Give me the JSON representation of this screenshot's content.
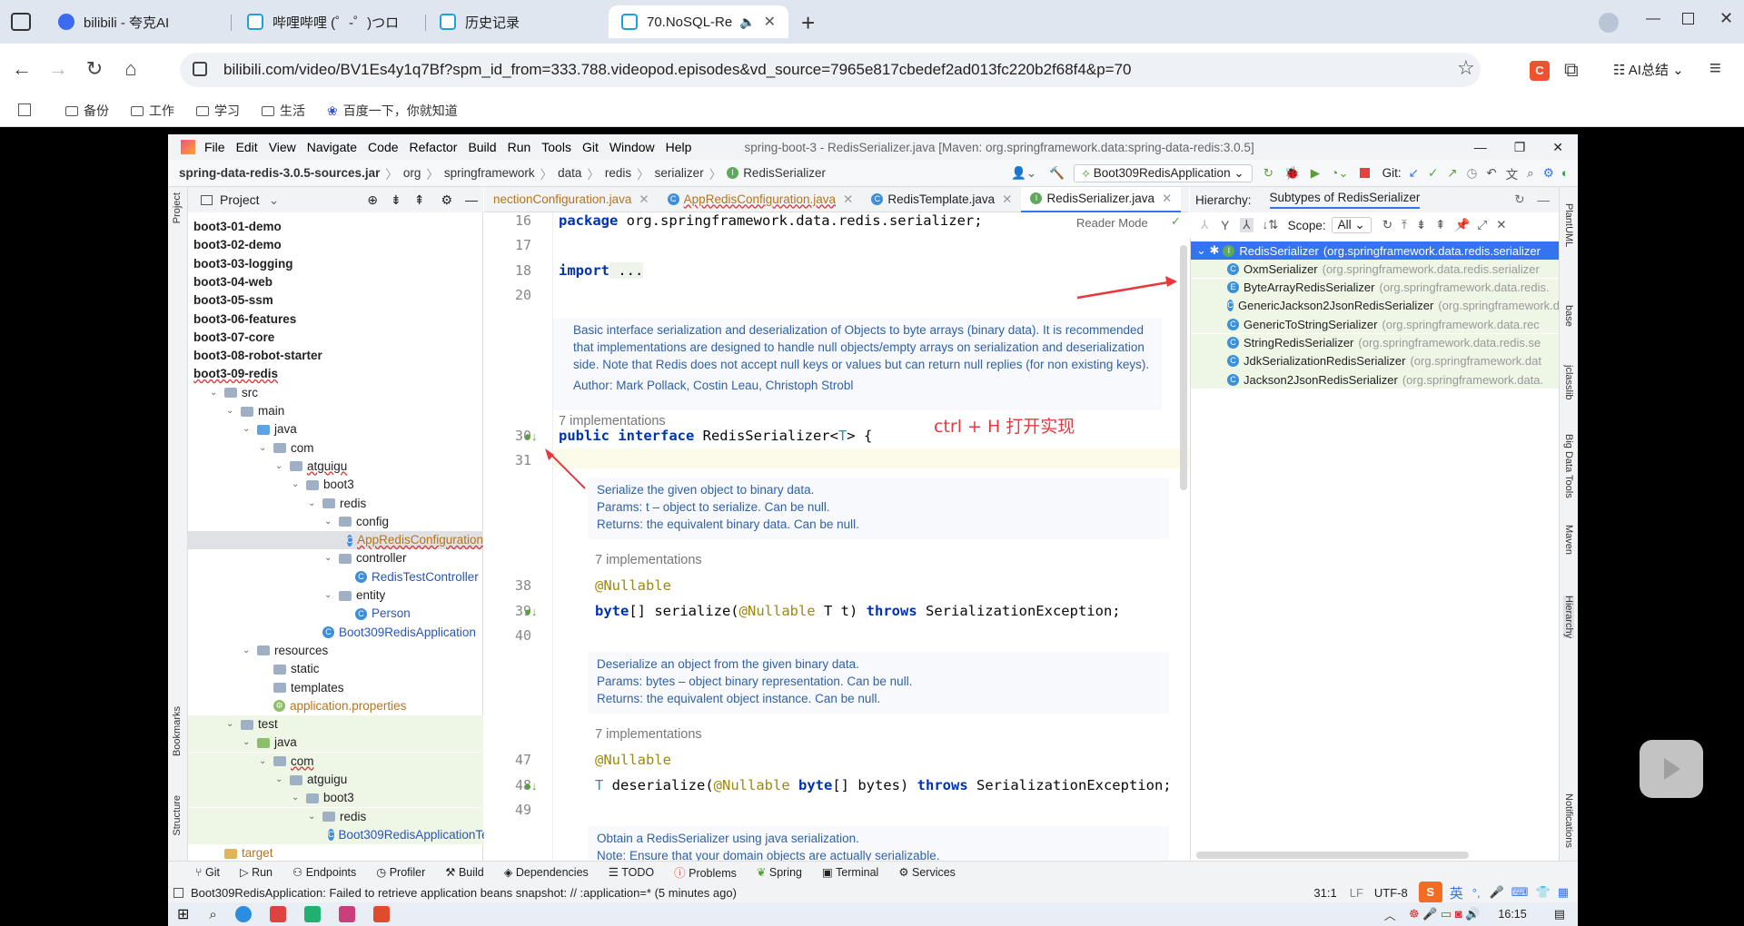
{
  "browser": {
    "tabs": [
      {
        "label": "bilibili - 夸克AI"
      },
      {
        "label": "哔哩哔哩 (゜-゜)つロ"
      },
      {
        "label": "历史记录"
      },
      {
        "label": "70.NoSQL-Re"
      }
    ],
    "url": "bilibili.com/video/BV1Es4y1q7Bf?spm_id_from=333.788.videopod.episodes&vd_source=7965e817cbedef2ad013fc220b2f68f4&p=70",
    "ai_summary_label": "AI总结",
    "bookmarks": [
      "备份",
      "工作",
      "学习",
      "生活",
      "百度一下，你就知道"
    ]
  },
  "ide": {
    "menu": [
      "File",
      "Edit",
      "View",
      "Navigate",
      "Code",
      "Refactor",
      "Build",
      "Run",
      "Tools",
      "Git",
      "Window",
      "Help"
    ],
    "window_title": "spring-boot-3 - RedisSerializer.java [Maven: org.springframework.data:spring-data-redis:3.0.5]",
    "breadcrumb": [
      "spring-data-redis-3.0.5-sources.jar",
      "org",
      "springframework",
      "data",
      "redis",
      "serializer",
      "RedisSerializer"
    ],
    "run_config": "Boot309RedisApplication",
    "git_label": "Git:",
    "project_panel": {
      "title": "Project",
      "tree": [
        {
          "label": "boot3-01-demo",
          "bold": true
        },
        {
          "label": "boot3-02-demo",
          "bold": true
        },
        {
          "label": "boot3-03-logging",
          "bold": true
        },
        {
          "label": "boot3-04-web",
          "bold": true
        },
        {
          "label": "boot3-05-ssm",
          "bold": true
        },
        {
          "label": "boot3-06-features",
          "bold": true
        },
        {
          "label": "boot3-07-core",
          "bold": true
        },
        {
          "label": "boot3-08-robot-starter",
          "bold": true
        },
        {
          "label": "boot3-09-redis",
          "bold": true
        },
        {
          "label": "src"
        },
        {
          "label": "main"
        },
        {
          "label": "java"
        },
        {
          "label": "com"
        },
        {
          "label": "atguigu"
        },
        {
          "label": "boot3"
        },
        {
          "label": "redis"
        },
        {
          "label": "config"
        },
        {
          "label": "AppRedisConfiguration"
        },
        {
          "label": "controller"
        },
        {
          "label": "RedisTestController"
        },
        {
          "label": "entity"
        },
        {
          "label": "Person"
        },
        {
          "label": "Boot309RedisApplication"
        },
        {
          "label": "resources"
        },
        {
          "label": "static"
        },
        {
          "label": "templates"
        },
        {
          "label": "application.properties"
        },
        {
          "label": "test"
        },
        {
          "label": "java"
        },
        {
          "label": "com"
        },
        {
          "label": "atguigu"
        },
        {
          "label": "boot3"
        },
        {
          "label": "redis"
        },
        {
          "label": "Boot309RedisApplicationTest"
        },
        {
          "label": "target"
        }
      ]
    },
    "editor_tabs": [
      {
        "label": "nectionConfiguration.java"
      },
      {
        "label": "AppRedisConfiguration.java"
      },
      {
        "label": "RedisTemplate.java"
      },
      {
        "label": "RedisSerializer.java"
      }
    ],
    "reader_mode": "Reader Mode",
    "line_numbers": [
      "16",
      "17",
      "18",
      "20",
      "30",
      "31",
      "38",
      "39",
      "40",
      "47",
      "48",
      "49"
    ],
    "code": {
      "package_kw": "package",
      "package_name": " org.springframework.data.redis.serializer;",
      "import_kw": "import",
      "import_rest": " ...",
      "doc1": "Basic interface serialization and deserialization of Objects to byte arrays (binary data). It is recommended that implementations are designed to handle null objects/empty arrays on serialization and deserialization side. Note that Redis does not accept null keys or values but can return null replies (for non existing keys).",
      "doc1_author": "Author: Mark Pollack, Costin Leau, Christoph Strobl",
      "impl1": "7 implementations",
      "iface_kw": "public interface",
      "iface_name": " RedisSerializer<",
      "iface_t": "T",
      "iface_end": "> {",
      "doc2_line1": "Serialize the given object to binary data.",
      "doc2_line2": "Params: t – object to serialize. Can be null.",
      "doc2_line3": "Returns: the equivalent binary data. Can be null.",
      "impl2": "7 implementations",
      "nullable1": "@Nullable",
      "serialize_kw": "byte",
      "serialize_rest": "[] serialize(",
      "serialize_ann": "@Nullable",
      "serialize_param": " T t) ",
      "serialize_throws": "throws",
      "serialize_end": " SerializationException;",
      "doc3_line1": "Deserialize an object from the given binary data.",
      "doc3_line2": "Params: bytes – object binary representation. Can be null.",
      "doc3_line3": "Returns: the equivalent object instance. Can be null.",
      "impl3": "7 implementations",
      "nullable2": "@Nullable",
      "deser_t": "T",
      "deser_rest": " deserialize(",
      "deser_ann": "@Nullable",
      "deser_kw": " byte",
      "deser_param": "[] bytes) ",
      "deser_throws": "throws",
      "deser_end": " SerializationException;",
      "doc4_line1": "Obtain a RedisSerializer using java serialization.",
      "doc4_line2": "Note: Ensure that your domain objects are actually serializable."
    },
    "annotation_text": "ctrl + H 打开实现",
    "hierarchy": {
      "label": "Hierarchy:",
      "tab": "Subtypes of RedisSerializer",
      "scope_label": "Scope:",
      "scope_value": "All",
      "root": {
        "name": "RedisSerializer",
        "pkg": "(org.springframework.data.redis.serializer"
      },
      "items": [
        {
          "name": "OxmSerializer",
          "pkg": "(org.springframework.data.redis.serializer"
        },
        {
          "name": "ByteArrayRedisSerializer",
          "pkg": "(org.springframework.data.redis."
        },
        {
          "name": "GenericJackson2JsonRedisSerializer",
          "pkg": "(org.springframework.d"
        },
        {
          "name": "GenericToStringSerializer",
          "pkg": "(org.springframework.data.rec"
        },
        {
          "name": "StringRedisSerializer",
          "pkg": "(org.springframework.data.redis.se"
        },
        {
          "name": "JdkSerializationRedisSerializer",
          "pkg": "(org.springframework.dat"
        },
        {
          "name": "Jackson2JsonRedisSerializer",
          "pkg": "(org.springframework.data."
        }
      ]
    },
    "side_left": [
      "Project",
      "Bookmarks",
      "Structure"
    ],
    "side_right": [
      "PlantUML",
      "base",
      "jclasslib",
      "Big Data Tools",
      "Maven",
      "Hierarchy",
      "Notifications"
    ],
    "bottom_tools": [
      "Git",
      "Run",
      "Endpoints",
      "Profiler",
      "Build",
      "Dependencies",
      "TODO",
      "Problems",
      "Spring",
      "Terminal",
      "Services"
    ],
    "status_message": "Boot309RedisApplication: Failed to retrieve application beans snapshot: // :application=* (5 minutes ago)",
    "status_pos": "31:1",
    "status_lf": "LF",
    "status_enc": "UTF-8",
    "ime_label": "英",
    "clock": "16:15"
  }
}
